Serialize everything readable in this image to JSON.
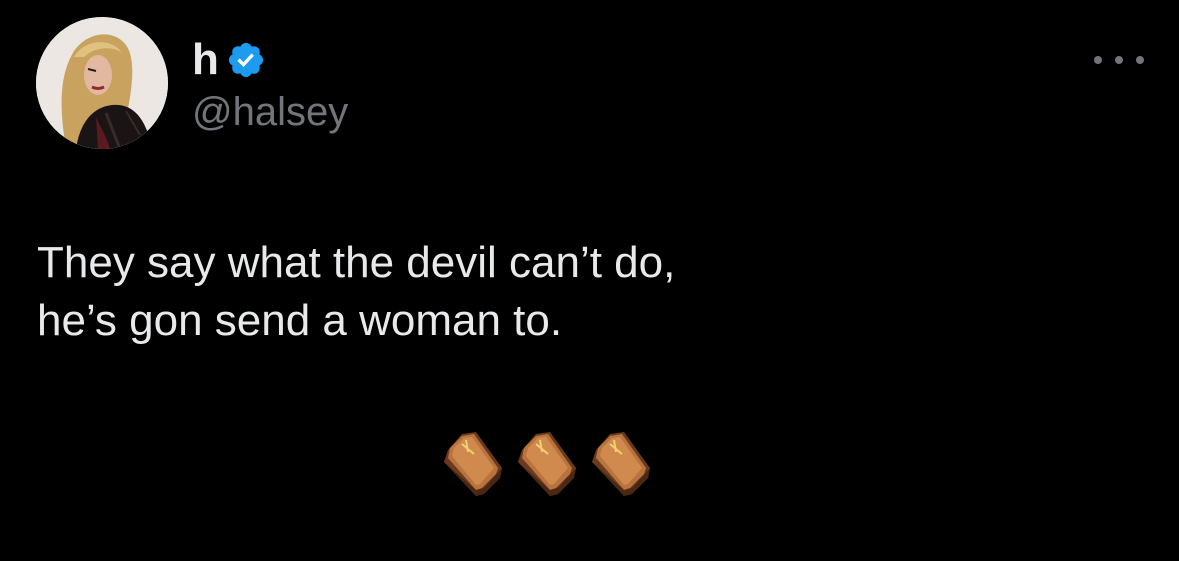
{
  "tweet": {
    "author": {
      "display_name": "h",
      "handle": "@halsey",
      "verified_color": "#1d9bf0"
    },
    "text_lines": [
      "They say what the devil can’t do,",
      "he’s gon send a woman to."
    ],
    "emoji": [
      "coffin",
      "coffin",
      "coffin"
    ],
    "more_icon": "more-horizontal-icon"
  },
  "colors": {
    "background": "#000000",
    "primary_text": "#e7e9ea",
    "secondary_text": "#71767b"
  }
}
